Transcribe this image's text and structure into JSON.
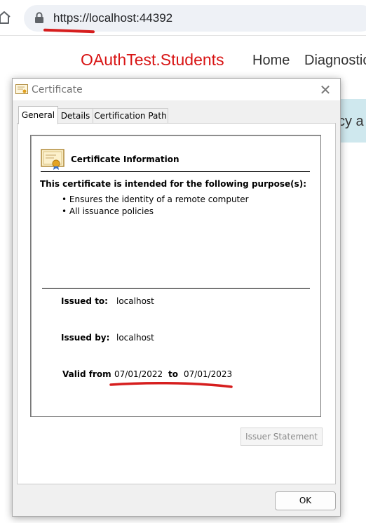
{
  "browser": {
    "url": "https://localhost:44392"
  },
  "site": {
    "brand": "OAuthTest.Students",
    "nav": [
      "Home",
      "Diagnostic"
    ],
    "banner_fragment": "cy a"
  },
  "dialog": {
    "title": "Certificate",
    "close_glyph": "✕",
    "tabs": [
      {
        "label": "General",
        "active": true
      },
      {
        "label": "Details",
        "active": false
      },
      {
        "label": "Certification Path",
        "active": false
      }
    ],
    "heading": "Certificate Information",
    "purpose_heading": "This certificate is intended for the following purpose(s):",
    "purposes": [
      "• Ensures the identity of a remote computer",
      "• All issuance policies"
    ],
    "issued_to_label": "Issued to:",
    "issued_to": "localhost",
    "issued_by_label": "Issued by:",
    "issued_by": "localhost",
    "valid_from_label": "Valid from",
    "valid_from": "07/01/2022",
    "to_label": "to",
    "valid_to": "07/01/2023",
    "issuer_button": "Issuer Statement",
    "ok_button": "OK"
  },
  "colors": {
    "brand_red": "#d81414",
    "annotation_red": "#d61e1e",
    "banner_bg": "#cfe8ee",
    "urlbar_bg": "#eef1f6"
  },
  "icons": [
    "home-icon",
    "lock-icon",
    "certificate-icon",
    "close-icon"
  ]
}
